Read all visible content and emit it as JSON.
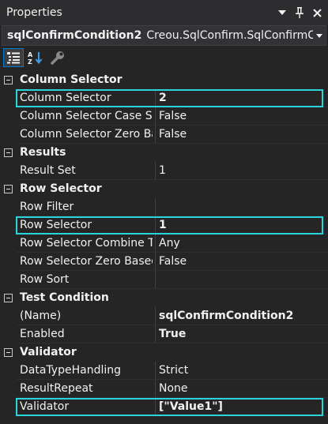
{
  "window": {
    "title": "Properties",
    "buttons": {
      "dropdown_icon": "chevron-down-icon",
      "pin_icon": "pin-icon",
      "close_icon": "close-icon"
    }
  },
  "object_selector": {
    "name": "sqlConfirmCondition2",
    "type": "Creou.SqlConfirm.SqlConfirmCondi"
  },
  "toolbar": {
    "categorized_icon": "categorized-icon",
    "alphabetical_icon": "alphabetical-icon",
    "property_pages_icon": "wrench-icon"
  },
  "colors": {
    "background": "#252526",
    "highlight": "#2bd4dc",
    "accent": "#007acc"
  },
  "categories": [
    {
      "label": "Column Selector",
      "props": [
        {
          "name": "Column Selector",
          "value": "2",
          "bold": true,
          "highlight": true
        },
        {
          "name": "Column Selector Case Sen",
          "value": "False"
        },
        {
          "name": "Column Selector Zero Bas",
          "value": "False"
        }
      ]
    },
    {
      "label": "Results",
      "props": [
        {
          "name": "Result Set",
          "value": "1"
        }
      ]
    },
    {
      "label": "Row Selector",
      "props": [
        {
          "name": "Row Filter",
          "value": ""
        },
        {
          "name": "Row Selector",
          "value": "1",
          "bold": true,
          "highlight": true
        },
        {
          "name": "Row Selector Combine Typ",
          "value": "Any"
        },
        {
          "name": "Row Selector Zero Based",
          "value": "False"
        },
        {
          "name": "Row Sort",
          "value": ""
        }
      ]
    },
    {
      "label": "Test Condition",
      "props": [
        {
          "name": "(Name)",
          "value": "sqlConfirmCondition2",
          "bold": true
        },
        {
          "name": "Enabled",
          "value": "True",
          "bold": true
        }
      ]
    },
    {
      "label": "Validator",
      "props": [
        {
          "name": "DataTypeHandling",
          "value": "Strict"
        },
        {
          "name": "ResultRepeat",
          "value": "None"
        },
        {
          "name": "Validator",
          "value": "[\"Value1\"]",
          "bold": true,
          "highlight": true
        }
      ]
    }
  ]
}
